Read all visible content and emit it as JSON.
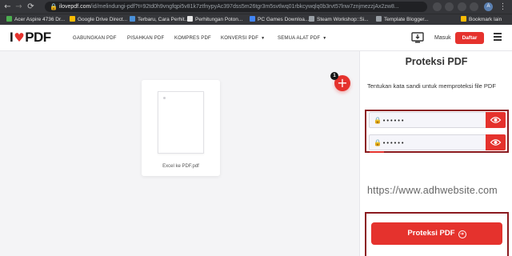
{
  "browser": {
    "url_host": "ilovepdf.com",
    "url_path": "/id/melindungi-pdf?t=92td0h9vngfqpi5v81k7ztfnypyAc397dss5m26tgr3m5svtlwq01rbkcywqlq0b3rvt57lnw7znjmezzjAx2zw8...",
    "bookmarks": [
      {
        "label": "Acer Aspire 4736 Dr...",
        "color": "#4caf50"
      },
      {
        "label": "Google Drive Direct...",
        "color": "#fbbc04"
      },
      {
        "label": "Terbaru, Cara Perhit...",
        "color": "#4a90d9"
      },
      {
        "label": "Perhitungan Poton...",
        "color": "#e8e8e8"
      },
      {
        "label": "PC Games Downloa...",
        "color": "#4285f4"
      },
      {
        "label": "Steam Workshop::Si...",
        "color": "#9aa0a6"
      },
      {
        "label": "Template Blogger...",
        "color": "#9aa0a6"
      },
      {
        "label": "Bookmark lain",
        "color": "#fbbc04"
      }
    ],
    "avatar_letter": "A"
  },
  "header": {
    "logo_left": "I",
    "logo_right": "PDF",
    "nav": [
      {
        "label": "GABUNGKAN PDF",
        "caret": ""
      },
      {
        "label": "PISAHKAN PDF",
        "caret": ""
      },
      {
        "label": "KOMPRES PDF",
        "caret": ""
      },
      {
        "label": "KONVERSI PDF",
        "caret": "▼"
      },
      {
        "label": "SEMUA ALAT PDF",
        "caret": "▼"
      }
    ],
    "login_label": "Masuk",
    "signup_label": "Daftar"
  },
  "workspace": {
    "file_name": "Excel ke PDF.pdf",
    "add_badge": "1",
    "add_symbol": "+"
  },
  "sidebar": {
    "title": "Proteksi PDF",
    "description": "Tentukan kata sandi untuk memproteksi file PDF",
    "password_value": "••••••",
    "confirm_value": "••••••",
    "watermark": "https://www.adhwebsite.com",
    "action_label": "Proteksi PDF",
    "action_arrow": "➔"
  },
  "colors": {
    "brand": "#e5322d",
    "highlight_border": "#8b1a1f"
  }
}
